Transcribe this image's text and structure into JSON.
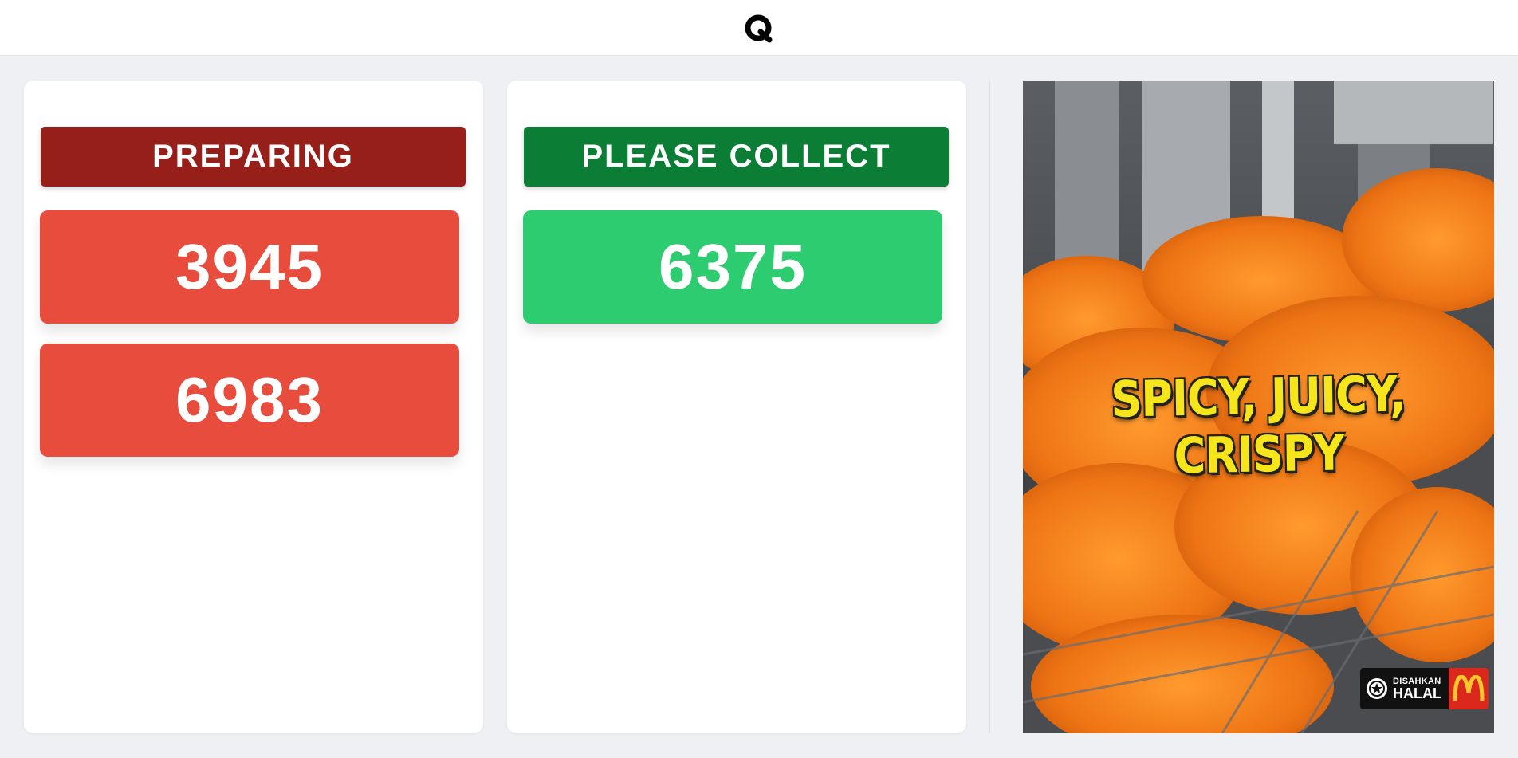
{
  "app": {
    "logo_icon": "q-logo-icon"
  },
  "preparing": {
    "title": "PREPARING",
    "orders": [
      "3945",
      "6983"
    ],
    "color": "#e84c3d",
    "header_color": "#962019"
  },
  "collect": {
    "title": "PLEASE COLLECT",
    "orders": [
      "6375"
    ],
    "color": "#2ecc71",
    "header_color": "#0b7d35"
  },
  "promo": {
    "headline": "SPICY, JUICY, CRISPY",
    "badge_small": "DISAHKAN",
    "badge_big": "HALAL",
    "brand_icon": "mcdonalds-logo-icon"
  }
}
